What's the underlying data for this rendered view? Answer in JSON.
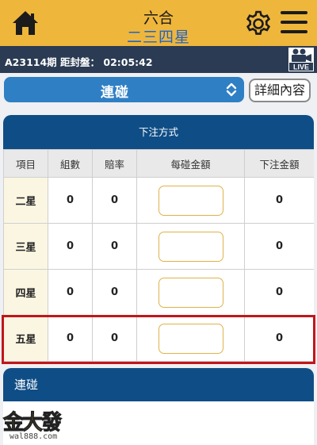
{
  "header": {
    "title": "六合",
    "subtitle": "二三四星"
  },
  "infobar": {
    "period_text": "A23114期 距封盤： 02:05:42",
    "live_label": "LIVE"
  },
  "selector": {
    "value": "連碰",
    "detail_button": "詳細內容"
  },
  "bet_panel": {
    "title": "下注方式",
    "columns": [
      "項目",
      "組數",
      "賠率",
      "每碰金額",
      "下注金額"
    ],
    "rows": [
      {
        "item": "二星",
        "groups": "0",
        "odds": "0",
        "bet_amount": "0"
      },
      {
        "item": "三星",
        "groups": "0",
        "odds": "0",
        "bet_amount": "0"
      },
      {
        "item": "四星",
        "groups": "0",
        "odds": "0",
        "bet_amount": "0"
      },
      {
        "item": "五星",
        "groups": "0",
        "odds": "0",
        "bet_amount": "0"
      }
    ],
    "highlighted_row": "五星"
  },
  "bottom_panel": {
    "title": "連碰"
  },
  "watermark": {
    "logo_text": "金大發",
    "logo_url_text": "wal888.com"
  },
  "colors": {
    "header_bg": "#efb63c",
    "infobar_bg": "#2b3b53",
    "accent_blue": "#2f7fc5",
    "panel_head": "#0f4d86",
    "highlight_border": "#c1161a",
    "input_border": "#e0b24a"
  },
  "icons": [
    "home-icon",
    "gear-icon",
    "menu-icon",
    "live-camera-icon",
    "chevron-updown-icon"
  ]
}
